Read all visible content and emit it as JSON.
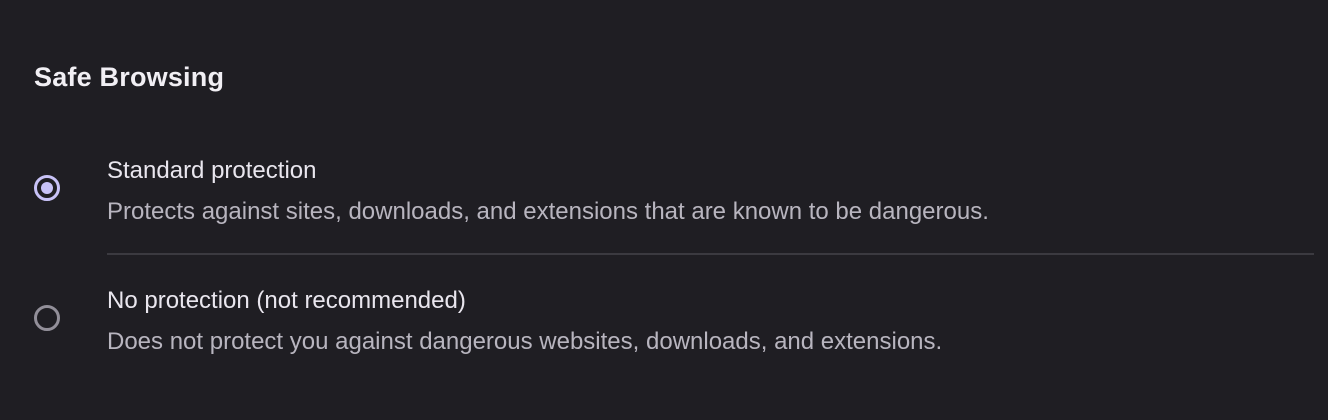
{
  "section": {
    "title": "Safe Browsing"
  },
  "options": [
    {
      "label": "Standard protection",
      "description": "Protects against sites, downloads, and extensions that are known to be dangerous.",
      "selected": true
    },
    {
      "label": "No protection (not recommended)",
      "description": "Does not protect you against dangerous websites, downloads, and extensions.",
      "selected": false
    }
  ],
  "colors": {
    "background": "#1f1e23",
    "accent": "#c8c2f7",
    "radio_unselected": "#928f99",
    "divider": "#3b3a40"
  }
}
